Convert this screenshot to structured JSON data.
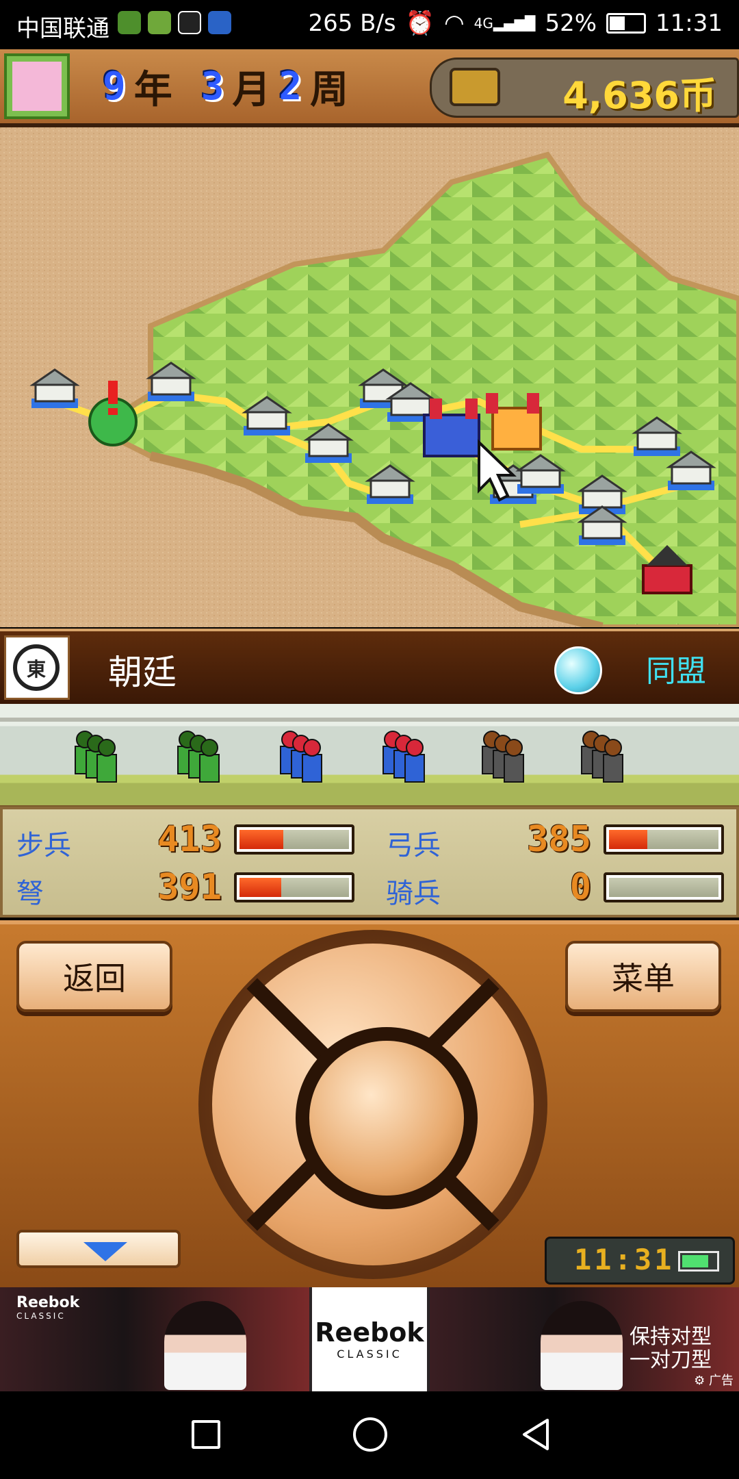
{
  "status_bar": {
    "carrier": "中国联通",
    "net_speed": "265 B/s",
    "signal": "4G",
    "battery": "52%",
    "battery_level": 0.52,
    "time": "11:31",
    "icons": [
      "alarm-icon",
      "wifi-icon",
      "signal-icon",
      "battery-icon"
    ]
  },
  "game_header": {
    "year_num": "9",
    "year_unit": "年",
    "month_num": "3",
    "month_unit": "月",
    "week_num": "2",
    "week_unit": "周",
    "money": "4,636币"
  },
  "faction": {
    "name": "朝廷",
    "crest_char": "東",
    "relation": "同盟",
    "accent": "#40e0f0"
  },
  "stats": {
    "items": [
      {
        "label": "步兵",
        "value": "413",
        "fill": 0.4
      },
      {
        "label": "弓兵",
        "value": "385",
        "fill": 0.35
      },
      {
        "label": "弩",
        "value": "391",
        "fill": 0.38
      },
      {
        "label": "骑兵",
        "value": "0",
        "fill": 0
      }
    ]
  },
  "controls": {
    "back_label": "返回",
    "menu_label": "菜单",
    "clock": "11:31",
    "battery_level": 0.8
  },
  "ad": {
    "brand": "Reebok",
    "brand_sub": "CLASSIC",
    "slogan_line1": "保持对型",
    "slogan_line2": "一对刀型",
    "ad_tag": "广告"
  }
}
